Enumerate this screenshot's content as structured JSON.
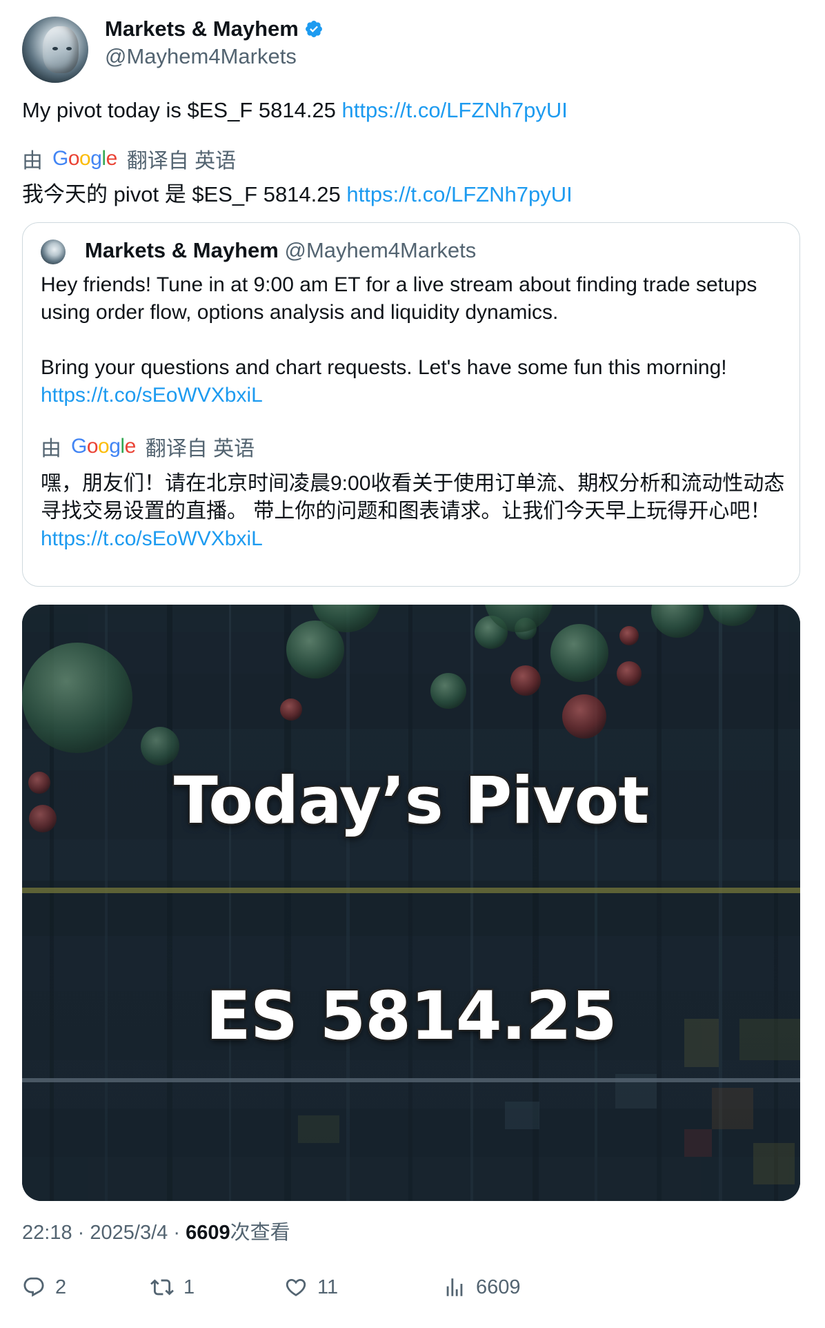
{
  "author": {
    "display_name": "Markets & Mayhem",
    "handle": "@Mayhem4Markets",
    "verified_icon": "verified-badge-icon"
  },
  "tweet": {
    "text": "My pivot today is $ES_F 5814.25 ",
    "link": "https://t.co/LFZNh7pyUI",
    "translate_by": "由",
    "translate_from": "翻译自 英语",
    "translated_text": "我今天的 pivot 是 $ES_F 5814.25 ",
    "translated_link": "https://t.co/LFZNh7pyUI"
  },
  "quote": {
    "display_name": "Markets & Mayhem",
    "handle": "@Mayhem4Markets",
    "paragraph1": "Hey friends! Tune in at 9:00 am ET for a live stream about finding trade setups using order flow, options analysis and liquidity dynamics.",
    "paragraph2": "Bring your questions and chart requests. Let's have some fun this morning!",
    "link": "https://t.co/sEoWVXbxiL",
    "translate_by": "由",
    "translate_from": "翻译自 英语",
    "translated_text": "嘿，朋友们！请在北京时间凌晨9:00收看关于使用订单流、期权分析和流动性动态寻找交易设置的直播。 带上你的问题和图表请求。让我们今天早上玩得开心吧！",
    "translated_link": "https://t.co/sEoWVXbxiL"
  },
  "media": {
    "title": "Today’s Pivot",
    "value": "ES 5814.25"
  },
  "meta": {
    "time": "22:18",
    "date": "2025/3/4",
    "separator": "·",
    "views": "6609",
    "views_label": "次查看"
  },
  "actions": {
    "replies": "2",
    "retweets": "1",
    "likes": "11",
    "views": "6609"
  },
  "google_logo": [
    "G",
    "o",
    "o",
    "g",
    "l",
    "e"
  ]
}
